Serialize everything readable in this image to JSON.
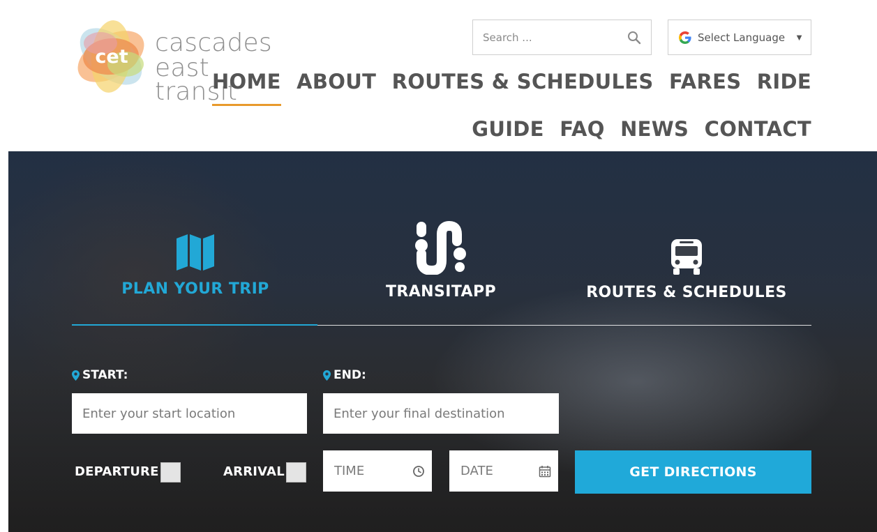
{
  "brand": {
    "logo_mark_text": "cet",
    "name_line1": "cascades east",
    "name_line2": "transit"
  },
  "search": {
    "placeholder": "Search ..."
  },
  "language": {
    "label": "Select Language",
    "caret": "▼"
  },
  "nav": {
    "row1": [
      "HOME",
      "ABOUT",
      "ROUTES & SCHEDULES",
      "FARES",
      "RIDE"
    ],
    "row2": [
      "GUIDE",
      "FAQ",
      "NEWS",
      "CONTACT"
    ],
    "active": "HOME"
  },
  "hero": {
    "tabs": [
      {
        "label": "PLAN YOUR TRIP",
        "icon": "map-icon",
        "active": true
      },
      {
        "label": "TRANSITAPP",
        "icon": "transitapp-icon",
        "active": false
      },
      {
        "label": "ROUTES & SCHEDULES",
        "icon": "bus-icon",
        "active": false
      }
    ],
    "start_label": "START:",
    "end_label": "END:",
    "start_placeholder": "Enter your start location",
    "end_placeholder": "Enter your final destination",
    "departure_label": "DEPARTURE",
    "arrival_label": "ARRIVAL",
    "time_placeholder": "TIME",
    "date_placeholder": "DATE",
    "submit_label": "GET DIRECTIONS"
  },
  "colors": {
    "accent_blue": "#20a9d9",
    "nav_underline": "#e89a2c",
    "nav_text": "#555555"
  }
}
